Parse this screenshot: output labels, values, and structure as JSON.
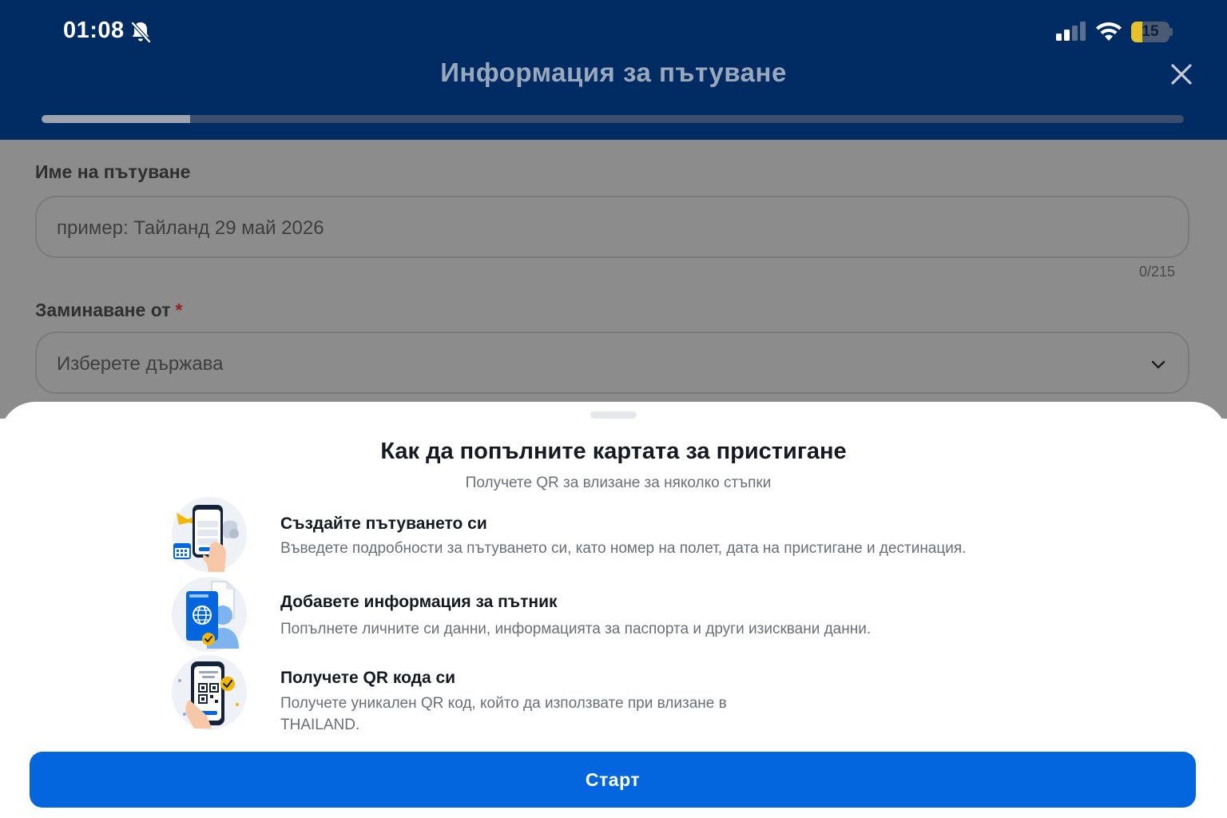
{
  "status_bar": {
    "time": "01:08",
    "battery": "15",
    "battery_level": 0.15,
    "icons": [
      "bell-slash-icon",
      "cellular-signal-icon",
      "wifi-icon",
      "battery-icon"
    ]
  },
  "header": {
    "title": "Информация за пътуване",
    "progress": 0.13,
    "close_icon": "close-icon"
  },
  "form": {
    "trip_name_label": "Име на пътуване",
    "trip_name_placeholder": "пример: Тайланд 29 май 2026",
    "trip_name_counter": "0/215",
    "departure_label": "Заминаване от",
    "required_mark": "*",
    "departure_placeholder": "Изберете държава",
    "departure_icon": "chevron-down-icon"
  },
  "sheet": {
    "title": "Как да попълните картата за пристигане",
    "subtitle": "Получете QR за влизане за няколко стъпки",
    "steps": [
      {
        "icon": "create-trip-icon",
        "title": "Създайте пътуването си",
        "description": "Въведете подробности за пътуването си, като номер на полет, дата на пристигане и дестинация."
      },
      {
        "icon": "passport-traveler-icon",
        "title": "Добавете информация за пътник",
        "description": "Попълнете личните си данни, информацията за паспорта и други изисквани данни."
      },
      {
        "icon": "qr-code-phone-icon",
        "title": "Получете QR кода си",
        "description_line1": "Получете уникален QR код, който да използвате при влизане в",
        "description_line2": "THAILAND."
      }
    ],
    "start_button": "Старт"
  },
  "colors": {
    "header_bg": "#002b63",
    "dim_overlay": "#8c8c8c",
    "primary_button": "#0466df",
    "battery_fill": "#e6c22a"
  }
}
